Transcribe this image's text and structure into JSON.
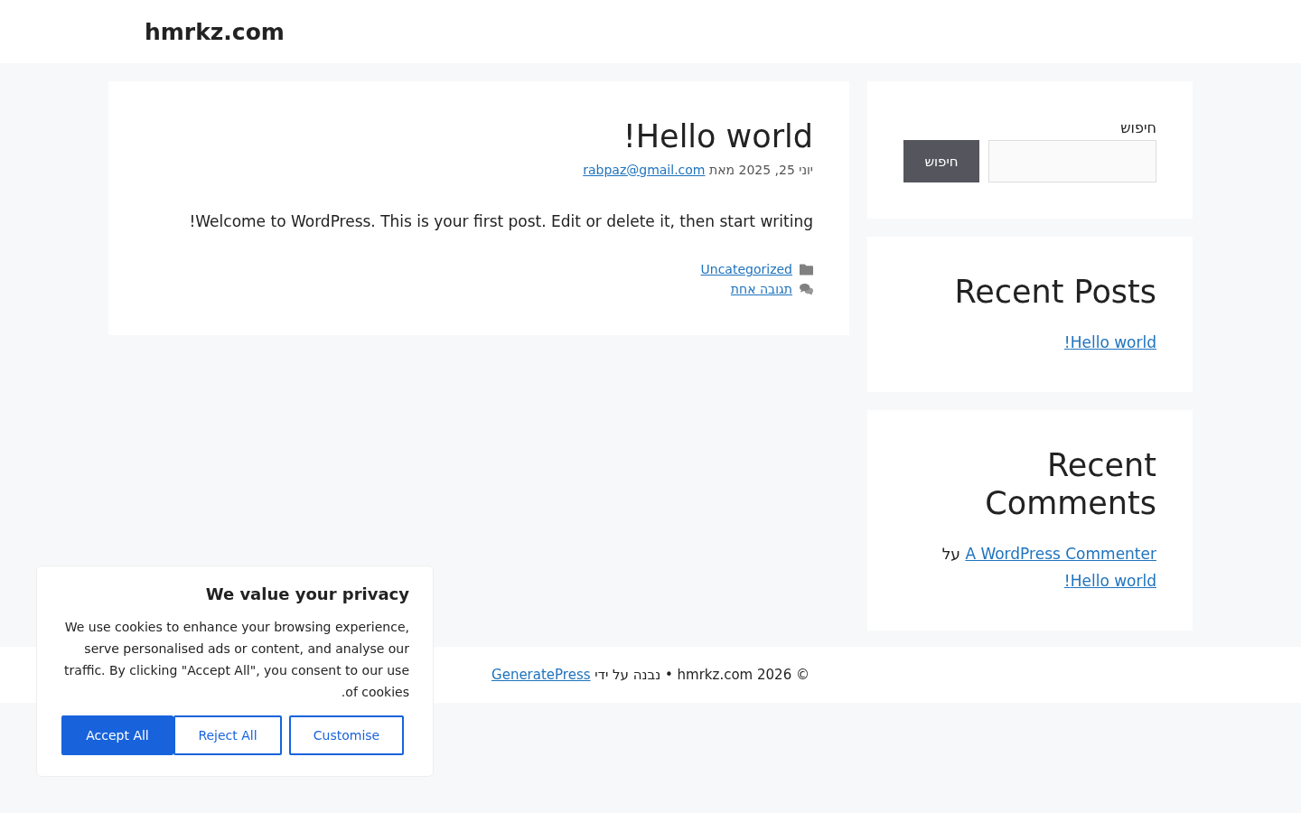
{
  "site_title": "hmrkz.com",
  "post": {
    "title": "Hello world!",
    "date": "יוני 25, 2025",
    "by": "מאת",
    "author": "rabpaz@gmail.com",
    "body": "Welcome to WordPress. This is your first post. Edit or delete it, then start writing!",
    "category": "Uncategorized",
    "comments_link": "תגובה אחת"
  },
  "sidebar": {
    "search": {
      "label": "חיפוש",
      "button": "חיפוש"
    },
    "recent_posts": {
      "title": "Recent Posts",
      "items": [
        "Hello world!"
      ]
    },
    "recent_comments": {
      "title": "Recent Comments",
      "items": [
        {
          "author": "A WordPress Commenter",
          "on": "על",
          "post": "Hello world!"
        }
      ]
    }
  },
  "footer": {
    "copyright": "© 2026 hmrkz.com • נבנה על ידי",
    "link": "GeneratePress"
  },
  "cookie_banner": {
    "title": "We value your privacy",
    "text": "We use cookies to enhance your browsing experience, serve personalised ads or content, and analyse our traffic. By clicking \"Accept All\", you consent to our use of cookies.",
    "buttons": [
      {
        "label": "Accept All",
        "kind": "primary"
      },
      {
        "label": "Reject All",
        "kind": "outline"
      },
      {
        "label": "Customise",
        "kind": "outline"
      }
    ]
  }
}
